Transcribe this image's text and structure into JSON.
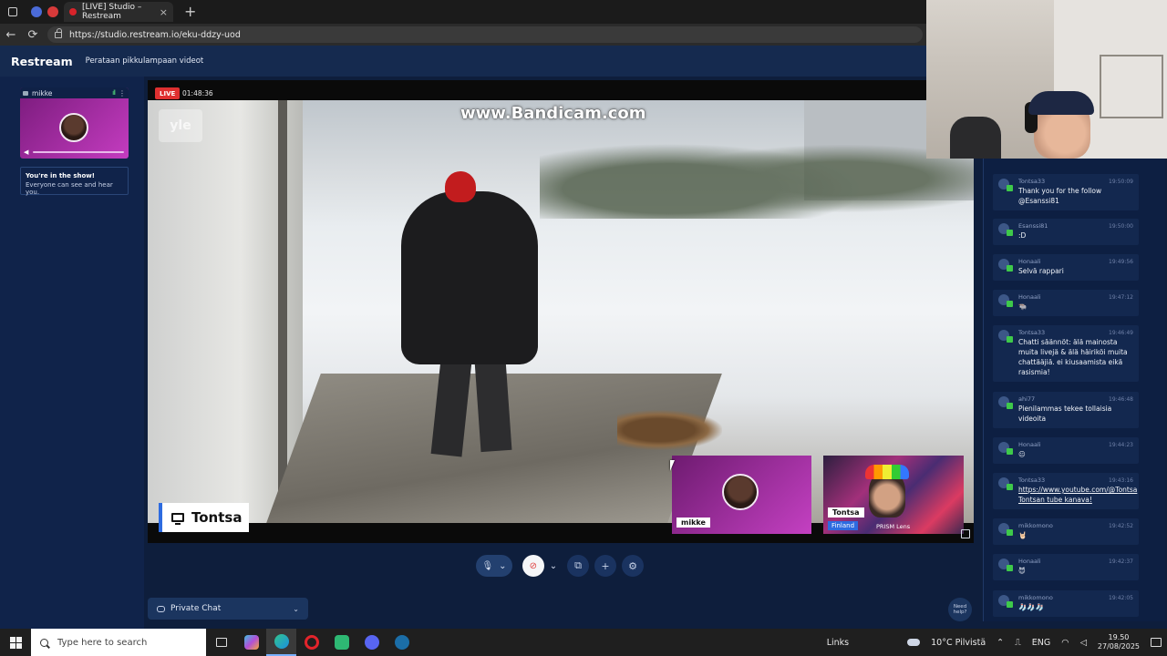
{
  "browser": {
    "tab_title": "[LIVE] Studio – Restream",
    "tab_close": "×",
    "new_tab": "+",
    "back": "←",
    "reload": "⟳",
    "url": "https://studio.restream.io/eku-ddzy-uod"
  },
  "app": {
    "brand": "Restream",
    "stream_title": "Perataan pikkulampaan videot"
  },
  "left_panel": {
    "guest_name": "mikke",
    "signal": "ıll",
    "menu": "⋮",
    "in_show_title": "You're in the show!",
    "in_show_sub": "Everyone can see and hear you."
  },
  "stage": {
    "live_label": "LIVE",
    "elapsed": "01:48:36",
    "watermark": "www.Bandicam.com",
    "channel_logo": "yle",
    "host_label": "Tontsa"
  },
  "tiles": [
    {
      "name": "mikke"
    },
    {
      "name": "Tontsa",
      "sub": "Finland",
      "extra": "PRISM Lens"
    }
  ],
  "controls": {
    "mic": "🎙",
    "caret": "⌄",
    "cam": "⊘",
    "share": "⧉",
    "add": "+",
    "settings": "⚙"
  },
  "private_chat": {
    "label": "Private Chat",
    "caret": "⌄"
  },
  "need_help": "Need help?",
  "chat": [
    {
      "user": "Tontsa33",
      "time": "19:50:09",
      "text": "Thank you for the follow @Esanssi81"
    },
    {
      "user": "Esanssi81",
      "time": "19:50:00",
      "text": ":D"
    },
    {
      "user": "Honaali",
      "time": "19:49:56",
      "text": "Selvä rappari"
    },
    {
      "user": "Honaali",
      "time": "19:47:12",
      "text": "🐃"
    },
    {
      "user": "Tontsa33",
      "time": "19:46:49",
      "text": "Chatti säännöt: älä mainosta muita livejä & älä häiriköi muita chattääjiä. ei kiusaamista eikä rasismia!"
    },
    {
      "user": "ahi77",
      "time": "19:46:48",
      "text": "Pienilammas tekee tollaisia videoita"
    },
    {
      "user": "Honaali",
      "time": "19:44:23",
      "text": "😐"
    },
    {
      "user": "Tontsa33",
      "time": "19:43:16",
      "text": "https://www.youtube.com/@Tontsa Tontsan tube kanava!",
      "link": true
    },
    {
      "user": "mikkomono",
      "time": "19:42:52",
      "text": "🤘🏻"
    },
    {
      "user": "Honaali",
      "time": "19:42:37",
      "text": "😈"
    },
    {
      "user": "mikkomono",
      "time": "19:42:05",
      "text": "🧦🧦🧦"
    }
  ],
  "taskbar": {
    "search_placeholder": "Type here to search",
    "links_label": "Links",
    "weather": "10°C Pilvistä",
    "tray_caret": "⌃",
    "language": "ENG",
    "time": "19.50",
    "date": "27/08/2025"
  },
  "colors": {
    "app_bg": "#0e1e3c",
    "accent": "#2d6be0",
    "live_red": "#e03030",
    "chat_platform": "#3ec94a"
  }
}
